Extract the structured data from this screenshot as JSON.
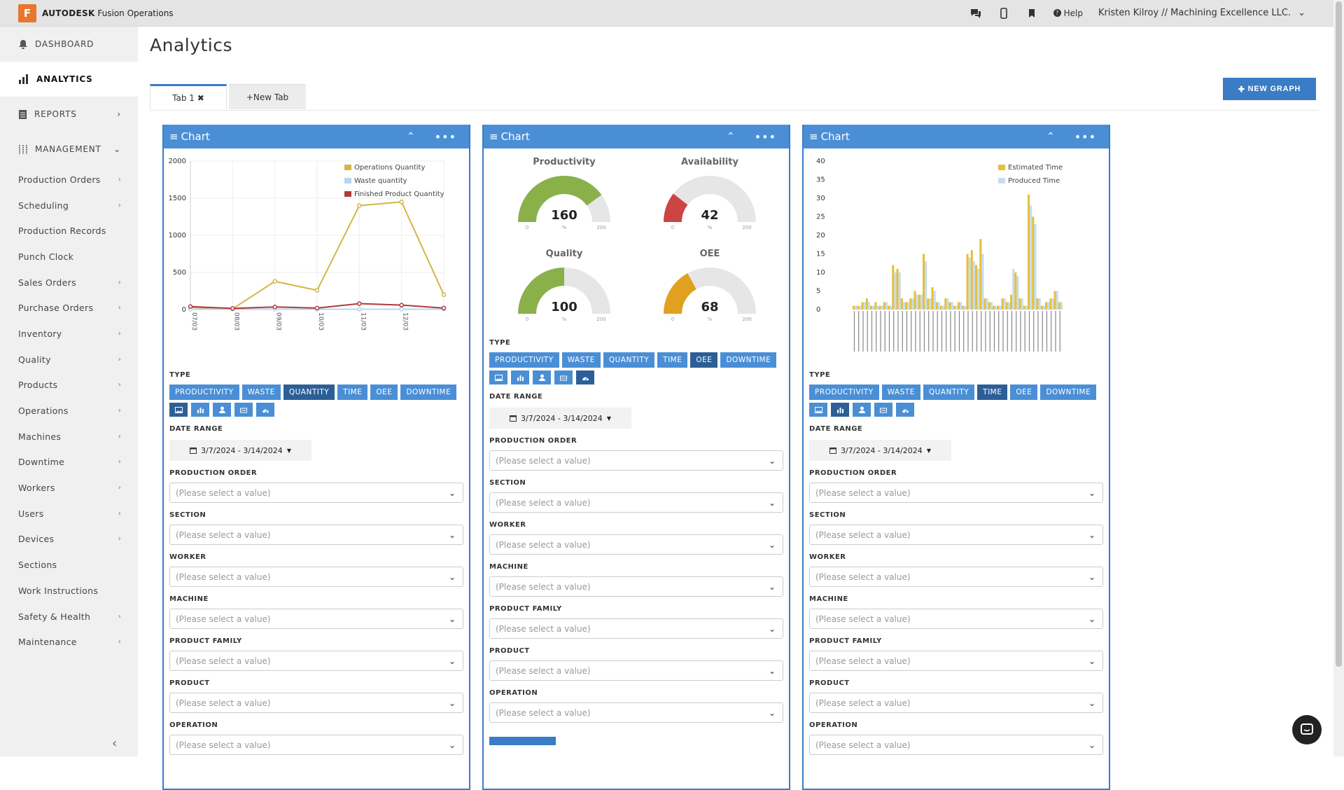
{
  "app": {
    "brand_bold": "AUTODESK",
    "brand_rest": " Fusion Operations",
    "logo_letter": "F"
  },
  "topbar": {
    "help": "Help",
    "user": "Kristen Kilroy // Machining Excellence LLC."
  },
  "sidebar": {
    "top": [
      {
        "label": "DASHBOARD",
        "icon": "bell-icon"
      },
      {
        "label": "ANALYTICS",
        "icon": "bar-chart-icon"
      },
      {
        "label": "REPORTS",
        "icon": "report-icon"
      },
      {
        "label": "MANAGEMENT",
        "icon": "sliders-icon"
      }
    ],
    "items": [
      "Production Orders",
      "Scheduling",
      "Production Records",
      "Punch Clock",
      "Sales Orders",
      "Purchase Orders",
      "Inventory",
      "Quality",
      "Products",
      "Operations",
      "Machines",
      "Downtime",
      "Workers",
      "Users",
      "Devices",
      "Sections",
      "Work Instructions",
      "Safety & Health",
      "Maintenance"
    ],
    "items_with_chevron": [
      true,
      true,
      false,
      false,
      true,
      true,
      true,
      true,
      true,
      true,
      true,
      true,
      true,
      true,
      true,
      false,
      false,
      true,
      true
    ]
  },
  "page": {
    "title": "Analytics",
    "tab1": "Tab 1",
    "tab2": "+New Tab",
    "new_graph": "NEW GRAPH"
  },
  "panel": {
    "title": "Chart",
    "type_label": "TYPE",
    "date_label": "DATE RANGE",
    "date_value": "3/7/2024 - 3/14/2024",
    "types": [
      "PRODUCTIVITY",
      "WASTE",
      "QUANTITY",
      "TIME",
      "OEE",
      "DOWNTIME"
    ],
    "placeholder": "(Please select a value)",
    "fields": [
      "PRODUCTION ORDER",
      "SECTION",
      "WORKER",
      "MACHINE",
      "PRODUCT FAMILY",
      "PRODUCT",
      "OPERATION"
    ]
  },
  "chart_data": [
    {
      "type": "line",
      "x": [
        "07/03",
        "08/03",
        "09/03",
        "10/03",
        "11/03",
        "12/03",
        ""
      ],
      "ylim": [
        0,
        2000
      ],
      "yticks": [
        0,
        500,
        1000,
        1500,
        2000
      ],
      "series": [
        {
          "name": "Operations Quantity",
          "color": "#d4b646",
          "values": [
            30,
            10,
            380,
            260,
            1400,
            1450,
            200
          ]
        },
        {
          "name": "Waste quantity",
          "color": "#b8d4f0",
          "values": [
            5,
            5,
            5,
            5,
            5,
            5,
            5
          ]
        },
        {
          "name": "Finished Product Quantity",
          "color": "#b03a3a",
          "values": [
            40,
            15,
            35,
            20,
            80,
            60,
            20
          ]
        }
      ]
    },
    {
      "type": "gauge",
      "gauges": [
        {
          "title": "Productivity",
          "value": 160,
          "max": 200,
          "color": "#8ab04a",
          "unit": "%",
          "min": 0
        },
        {
          "title": "Availability",
          "value": 42,
          "max": 200,
          "color": "#cc4444",
          "unit": "%",
          "min": 0
        },
        {
          "title": "Quality",
          "value": 100,
          "max": 200,
          "color": "#8ab04a",
          "unit": "%",
          "min": 0
        },
        {
          "title": "OEE",
          "value": 68,
          "max": 200,
          "color": "#e0a020",
          "unit": "%",
          "min": 0
        }
      ]
    },
    {
      "type": "bar",
      "ylim": [
        0,
        40
      ],
      "yticks": [
        0,
        5,
        10,
        15,
        20,
        25,
        30,
        35,
        40
      ],
      "series": [
        {
          "name": "Estimated Time",
          "color": "#e6c03a"
        },
        {
          "name": "Produced Time",
          "color": "#c6dcf0"
        }
      ],
      "estimated": [
        1,
        1,
        2,
        3,
        1,
        2,
        1,
        2,
        1,
        12,
        11,
        3,
        2,
        3,
        5,
        4,
        15,
        3,
        6,
        2,
        1,
        3,
        2,
        1,
        2,
        1,
        15,
        16,
        12,
        19,
        3,
        2,
        1,
        1,
        3,
        2,
        4,
        10,
        3,
        1,
        31,
        25,
        3,
        1,
        2,
        3,
        5,
        2
      ],
      "produced": [
        1,
        1,
        2,
        2,
        1,
        1,
        1,
        2,
        1,
        10,
        10,
        2,
        2,
        3,
        4,
        4,
        13,
        3,
        5,
        2,
        1,
        3,
        2,
        1,
        2,
        1,
        14,
        13,
        11,
        15,
        3,
        2,
        1,
        1,
        3,
        2,
        11,
        9,
        3,
        1,
        28,
        23,
        3,
        1,
        2,
        3,
        5,
        2
      ]
    }
  ]
}
